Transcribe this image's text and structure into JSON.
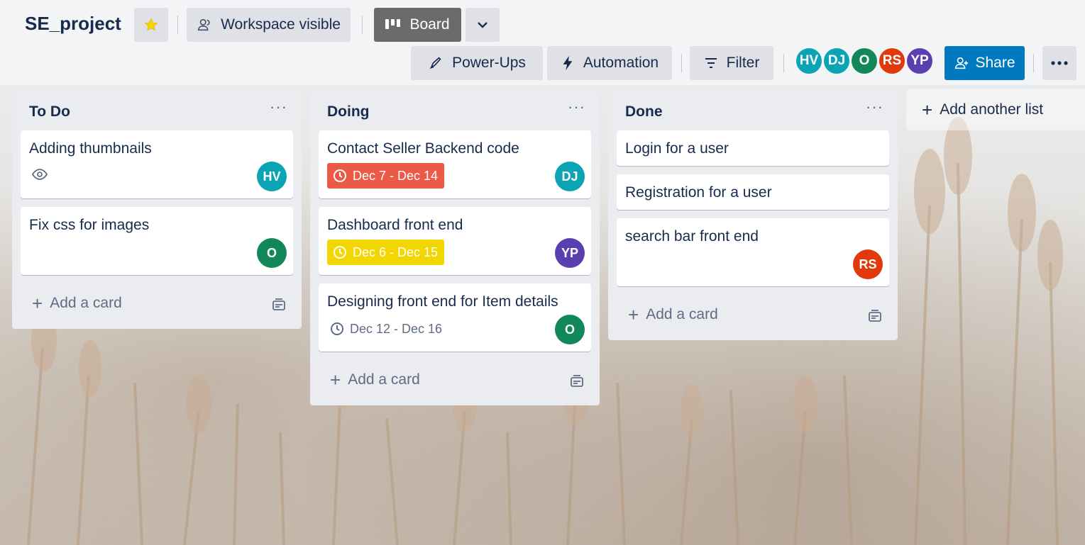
{
  "board": {
    "title": "SE_project",
    "visibility_label": "Workspace visible",
    "view_label": "Board"
  },
  "header": {
    "powerups_label": "Power-Ups",
    "automation_label": "Automation",
    "filter_label": "Filter",
    "share_label": "Share",
    "members": [
      {
        "initials": "HV",
        "color": "#0aa4b5"
      },
      {
        "initials": "DJ",
        "color": "#0aa4b5"
      },
      {
        "initials": "O",
        "color": "#12875a"
      },
      {
        "initials": "RS",
        "color": "#e2390c"
      },
      {
        "initials": "YP",
        "color": "#5a3fb0"
      }
    ]
  },
  "lists": [
    {
      "title": "To Do",
      "add_card_label": "Add a card",
      "cards": [
        {
          "title": "Adding thumbnails",
          "watch_icon": "eye-icon",
          "member": "HV"
        },
        {
          "title": "Fix css for images",
          "member": "O"
        }
      ]
    },
    {
      "title": "Doing",
      "add_card_label": "Add a card",
      "cards": [
        {
          "title": "Contact Seller Backend code",
          "due": "Dec 7 - Dec 14",
          "due_status": "overdue",
          "due_color": "#eb5a46",
          "member": "DJ"
        },
        {
          "title": "Dashboard front end",
          "due": "Dec 6 - Dec 15",
          "due_status": "due-soon",
          "due_color": "#f2d600",
          "member": "YP"
        },
        {
          "title": "Designing front end for Item details",
          "due": "Dec 12 - Dec 16",
          "due_status": "normal",
          "member": "O"
        }
      ]
    },
    {
      "title": "Done",
      "add_card_label": "Add a card",
      "cards": [
        {
          "title": "Login for a user"
        },
        {
          "title": "Registration for a user"
        },
        {
          "title": "search bar front end",
          "member": "RS"
        }
      ]
    }
  ],
  "add_list_label": "Add another list",
  "colors": {
    "share_blue": "#0079bf",
    "board_button_dark": "#6b6b6b",
    "list_bg": "#ebecf0"
  }
}
